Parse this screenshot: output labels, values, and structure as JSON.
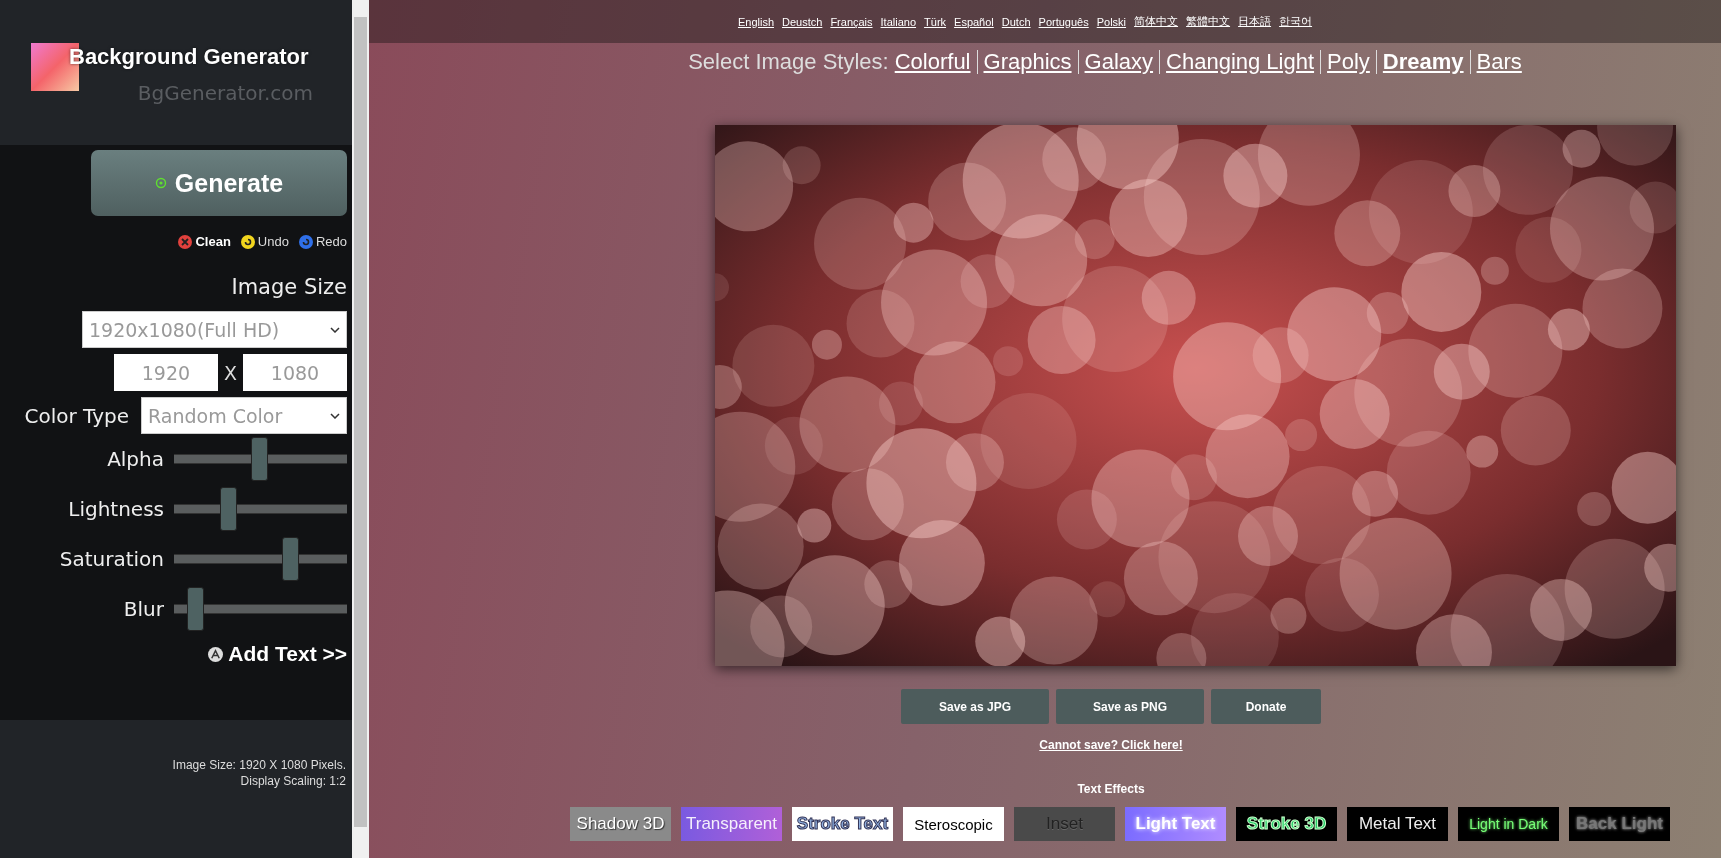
{
  "sidebar": {
    "logo_title": "Background Generator",
    "logo_subtitle": "BgGenerator.com",
    "generate_button": "Generate",
    "actions": [
      {
        "kind": "clean",
        "label": "Clean"
      },
      {
        "kind": "undo",
        "label": "Undo"
      },
      {
        "kind": "redo",
        "label": "Redo"
      }
    ],
    "image_size_heading": "Image Size",
    "size_select": "1920x1080(Full HD)",
    "width_field": {
      "placeholder": "1920"
    },
    "times_sign": "X",
    "height_field": {
      "placeholder": "1080"
    },
    "color_type_label": "Color Type",
    "color_type_select": "Random Color",
    "sliders": [
      {
        "label": "Alpha",
        "level": 0.49
      },
      {
        "label": "Lightness",
        "level": 0.31
      },
      {
        "label": "Saturation",
        "level": 0.67
      },
      {
        "label": "Blur",
        "level": 0.12
      }
    ],
    "add_text_link": "Add Text >>",
    "info": [
      "Image Size: 1920 X 1080 Pixels.",
      "Display Scaling: 1:2"
    ]
  },
  "languages": [
    "English",
    "Deustch",
    "Français",
    "Italiano",
    "Türk",
    "Español",
    "Dutch",
    "Português",
    "Polski",
    "简体中文",
    "繁體中文",
    "日本語",
    "한국어"
  ],
  "styles": {
    "label": "Select Image Styles:",
    "items": [
      {
        "label": "Colorful",
        "selected": false
      },
      {
        "label": "Graphics",
        "selected": false
      },
      {
        "label": "Galaxy",
        "selected": false
      },
      {
        "label": "Changing Light",
        "selected": false
      },
      {
        "label": "Poly",
        "selected": false
      },
      {
        "label": "Dreamy",
        "selected": true
      },
      {
        "label": "Bars",
        "selected": false
      }
    ]
  },
  "save_buttons": [
    "Save as JPG",
    "Save as PNG",
    "Donate"
  ],
  "cannot_save_link": "Cannot save? Click here!",
  "text_effects": {
    "title": "Text Effects",
    "items": [
      {
        "kind": "shadow3d",
        "label": "Shadow 3D"
      },
      {
        "kind": "transparent",
        "label": "Transparent"
      },
      {
        "kind": "stroke",
        "label": "Stroke Text"
      },
      {
        "kind": "stereoscopic",
        "label": "Steroscopic"
      },
      {
        "kind": "inset",
        "label": "Inset"
      },
      {
        "kind": "light",
        "label": "Light Text"
      },
      {
        "kind": "stroke3d",
        "label": "Stroke 3D"
      },
      {
        "kind": "metal",
        "label": "Metal Text"
      },
      {
        "kind": "lightdark",
        "label": "Light in Dark"
      },
      {
        "kind": "backlight",
        "label": "Back Light"
      }
    ]
  }
}
